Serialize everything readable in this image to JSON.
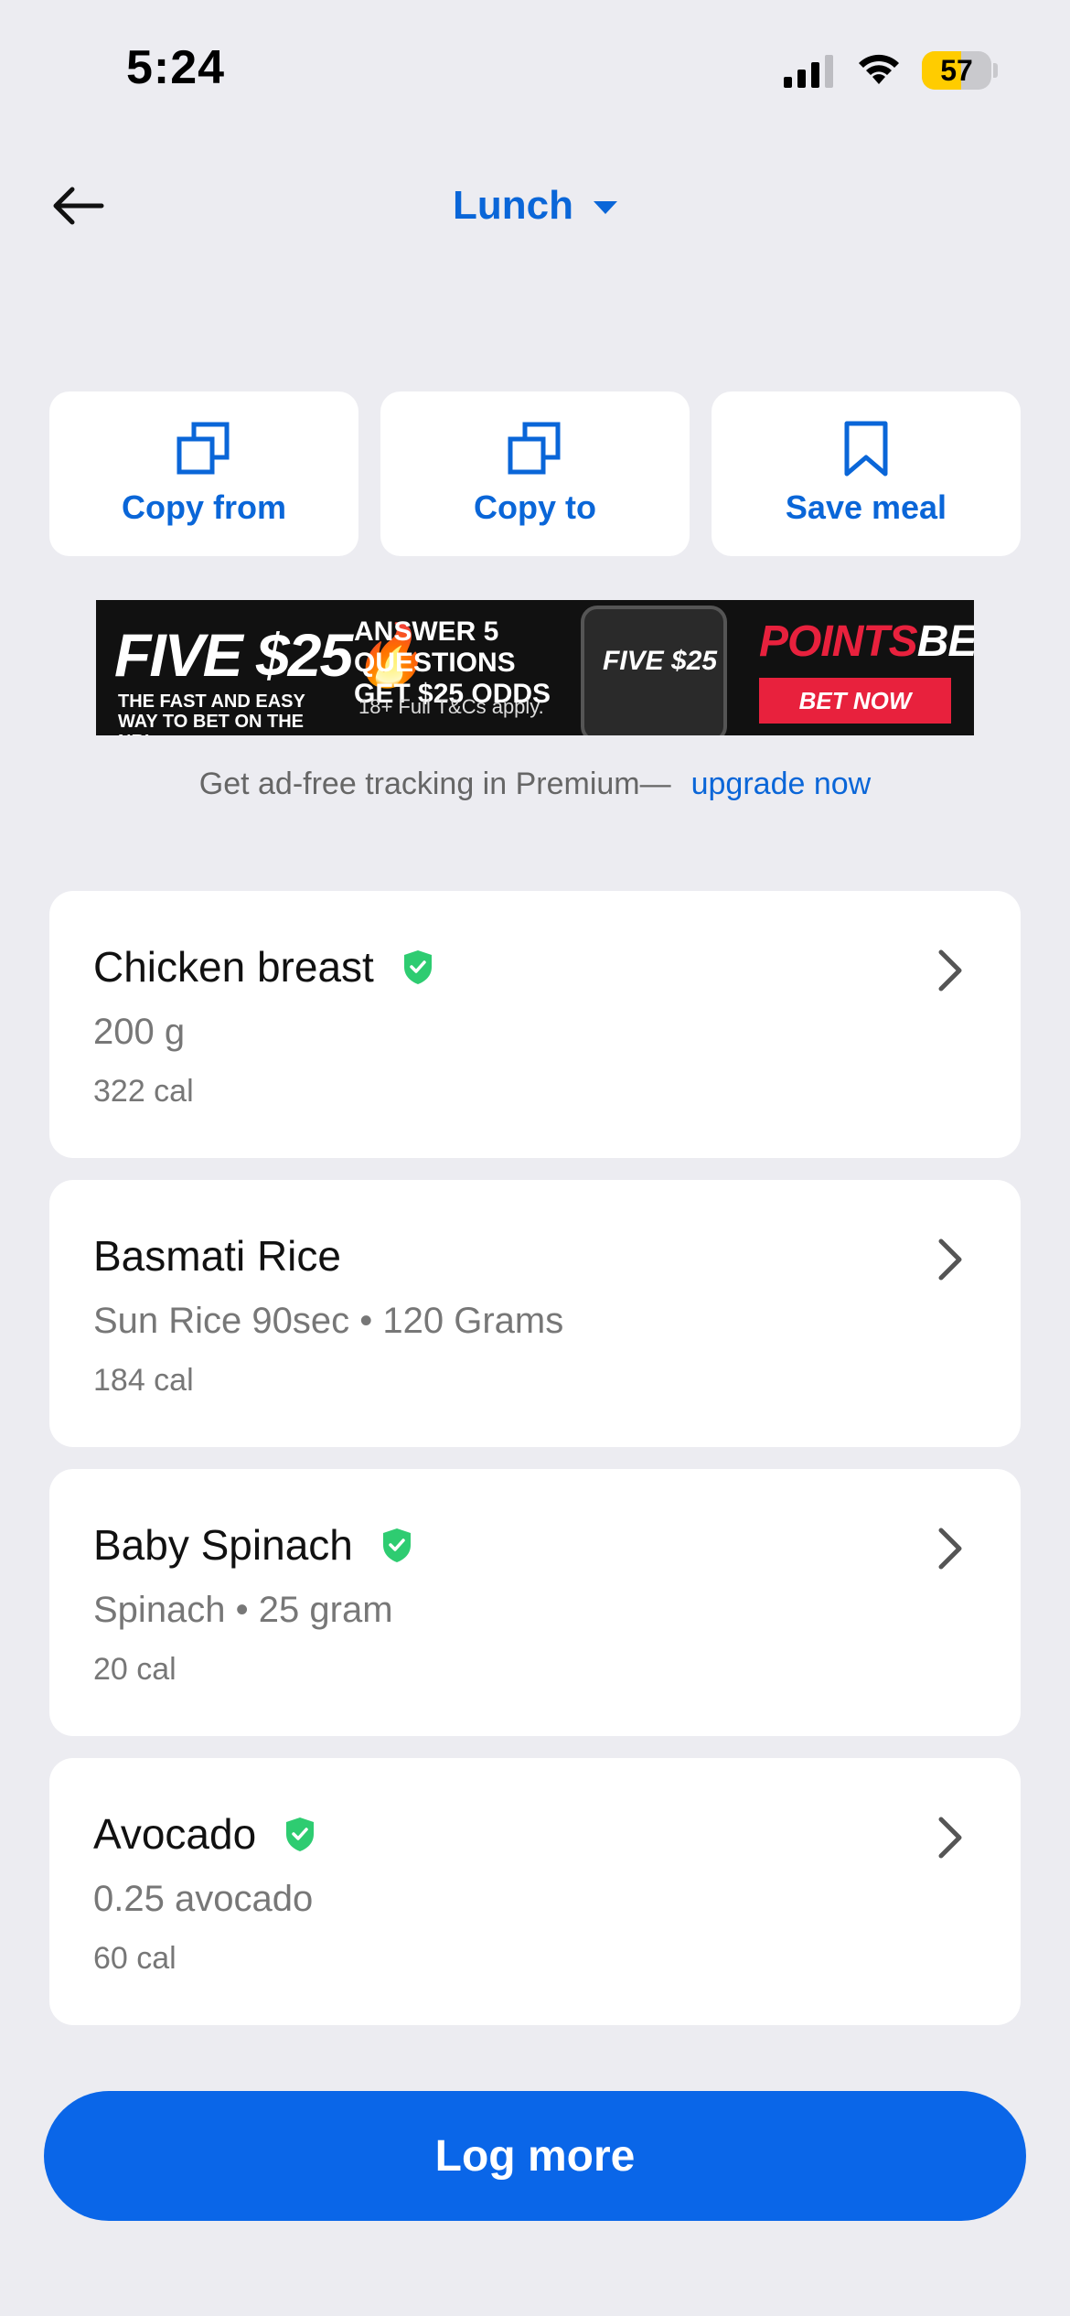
{
  "status_bar": {
    "time": "5:24",
    "battery": "57",
    "battery_level": 0.57
  },
  "header": {
    "title": "Lunch"
  },
  "actions": [
    {
      "label": "Copy from",
      "icon": "copy-icon"
    },
    {
      "label": "Copy to",
      "icon": "copy-icon"
    },
    {
      "label": "Save meal",
      "icon": "bookmark-icon"
    }
  ],
  "ad": {
    "headline_left": "FIVE $25",
    "tagline": "THE FAST AND EASY WAY TO BET ON THE NRL",
    "question": "ANSWER 5 QUESTIONS GET $25 ODDS",
    "terms": "18+ Full T&Cs apply.",
    "brand_part1": "POINTS",
    "brand_part2": "BET",
    "cta": "BET NOW",
    "phone_text": "FIVE $25"
  },
  "premium": {
    "text": "Get ad-free tracking in Premium—",
    "link": "upgrade now"
  },
  "foods": [
    {
      "name": "Chicken breast",
      "verified": true,
      "detail": "200 g",
      "calories": "322 cal"
    },
    {
      "name": "Basmati Rice",
      "verified": false,
      "detail": "Sun Rice 90sec • 120 Grams",
      "calories": "184 cal"
    },
    {
      "name": "Baby Spinach",
      "verified": true,
      "detail": "Spinach • 25 gram",
      "calories": "20 cal"
    },
    {
      "name": "Avocado",
      "verified": true,
      "detail": "0.25 avocado",
      "calories": "60 cal"
    }
  ],
  "log_more": "Log more",
  "colors": {
    "accent": "#0a66d8",
    "verified": "#2ecc71",
    "background": "#ececf1",
    "battery": "#ffcc00"
  }
}
